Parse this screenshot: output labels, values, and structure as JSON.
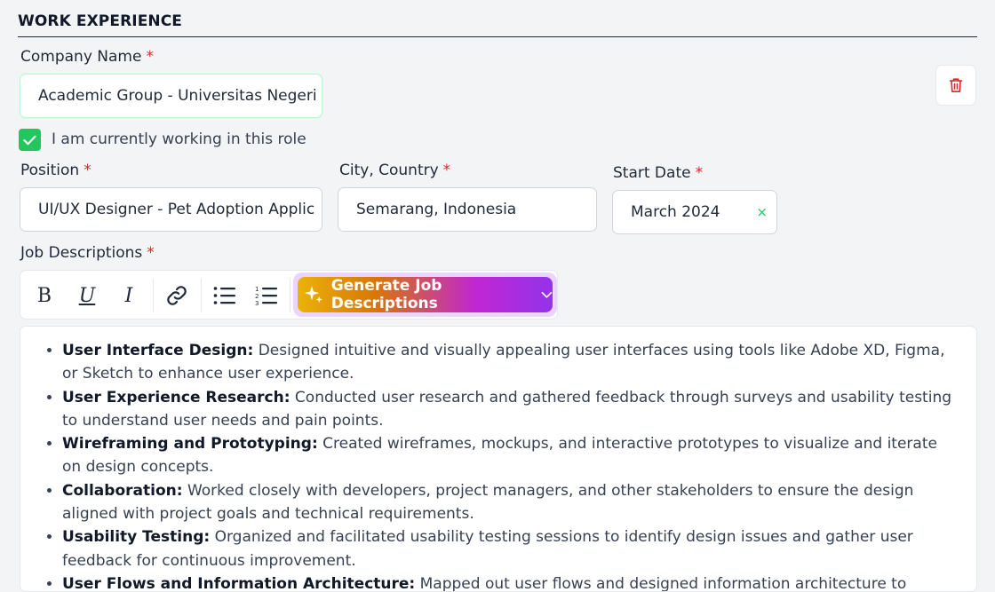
{
  "section": {
    "title": "WORK EXPERIENCE"
  },
  "company": {
    "label": "Company Name",
    "required_mark": "*",
    "value": "Academic Group - Universitas Negeri"
  },
  "current_role": {
    "checked": true,
    "label": "I am currently working in this role"
  },
  "position": {
    "label": "Position",
    "required_mark": "*",
    "value": "UI/UX Designer - Pet Adoption Applic"
  },
  "city": {
    "label": "City, Country",
    "required_mark": "*",
    "value": "Semarang, Indonesia"
  },
  "start_date": {
    "label": "Start Date",
    "required_mark": "*",
    "value": "March 2024",
    "clear_glyph": "×"
  },
  "job_descriptions": {
    "label": "Job Descriptions",
    "required_mark": "*",
    "toolbar": {
      "bold": "B",
      "underline": "U",
      "italic": "I",
      "generate_label": "Generate Job Descriptions"
    },
    "items": [
      {
        "title": "User Interface Design:",
        "text": "Designed intuitive and visually appealing user interfaces using tools like Adobe XD, Figma, or Sketch to enhance user experience."
      },
      {
        "title": "User Experience Research:",
        "text": "Conducted user research and gathered feedback through surveys and usability testing to understand user needs and pain points."
      },
      {
        "title": "Wireframing and Prototyping:",
        "text": "Created wireframes, mockups, and interactive prototypes to visualize and iterate on design concepts."
      },
      {
        "title": "Collaboration:",
        "text": "Worked closely with developers, project managers, and other stakeholders to ensure the design aligned with project goals and technical requirements."
      },
      {
        "title": "Usability Testing:",
        "text": "Organized and facilitated usability testing sessions to identify design issues and gather user feedback for continuous improvement."
      },
      {
        "title": "User Flows and Information Architecture:",
        "text": "Mapped out user flows and designed information architecture to create"
      }
    ]
  },
  "colors": {
    "accent_green": "#22c55e",
    "required_red": "#dc2626",
    "delete_red": "#dc2626"
  }
}
